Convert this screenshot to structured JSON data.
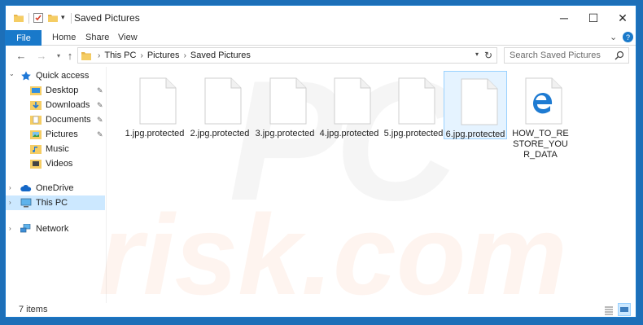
{
  "window": {
    "title": "Saved Pictures",
    "controls": {
      "minimize": "─",
      "maximize": "☐",
      "close": "✕"
    }
  },
  "ribbon": {
    "file_tab": "File",
    "tabs": [
      "Home",
      "Share",
      "View"
    ],
    "expand_icon": "chevron-down-icon",
    "help": "?"
  },
  "address": {
    "segments": [
      "This PC",
      "Pictures",
      "Saved Pictures"
    ]
  },
  "search": {
    "placeholder": "Search Saved Pictures"
  },
  "nav": {
    "quick_access": "Quick access",
    "quick_items": [
      {
        "label": "Desktop",
        "icon": "desktop-folder-icon",
        "pinned": true
      },
      {
        "label": "Downloads",
        "icon": "downloads-folder-icon",
        "pinned": true
      },
      {
        "label": "Documents",
        "icon": "documents-folder-icon",
        "pinned": true
      },
      {
        "label": "Pictures",
        "icon": "pictures-folder-icon",
        "pinned": true
      },
      {
        "label": "Music",
        "icon": "music-folder-icon",
        "pinned": false
      },
      {
        "label": "Videos",
        "icon": "videos-folder-icon",
        "pinned": false
      }
    ],
    "onedrive": "OneDrive",
    "this_pc": "This PC",
    "network": "Network"
  },
  "files": [
    {
      "name": "1.jpg.protected",
      "type": "blank"
    },
    {
      "name": "2.jpg.protected",
      "type": "blank"
    },
    {
      "name": "3.jpg.protected",
      "type": "blank"
    },
    {
      "name": "4.jpg.protected",
      "type": "blank"
    },
    {
      "name": "5.jpg.protected",
      "type": "blank"
    },
    {
      "name": "6.jpg.protected",
      "type": "blank",
      "selected": true
    },
    {
      "name": "HOW_TO_RESTORE_YOUR_DATA",
      "type": "edge-html"
    }
  ],
  "watermark": {
    "top": "PC",
    "bottom": "risk.com"
  },
  "status": {
    "item_count": "7 items"
  },
  "colors": {
    "accent": "#1979ca",
    "selection": "#cce8ff",
    "edge_blue": "#1e7bd2"
  }
}
